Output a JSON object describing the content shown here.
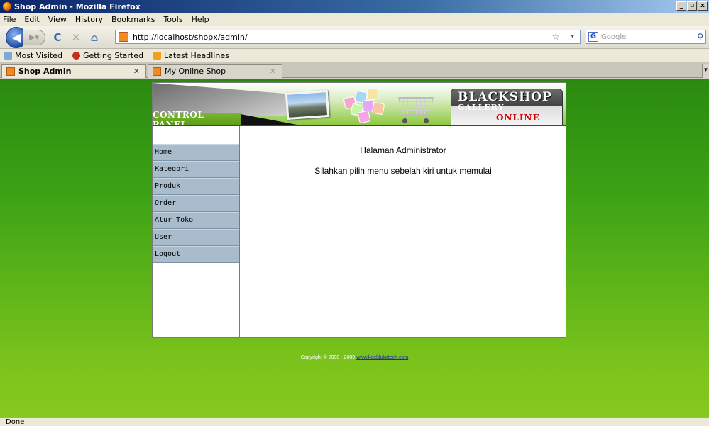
{
  "window": {
    "title": "Shop Admin - Mozilla Firefox",
    "controls": [
      "_",
      "▫",
      "x"
    ]
  },
  "menubar": {
    "items": [
      "File",
      "Edit",
      "View",
      "History",
      "Bookmarks",
      "Tools",
      "Help"
    ]
  },
  "navbar": {
    "back_icon": "back-arrow-icon",
    "forward_icon": "forward-arrow-icon",
    "url": "http://localhost/shopx/admin/",
    "search_placeholder": "Google",
    "search_engine_letter": "G"
  },
  "bookmarks": {
    "items": [
      "Most Visited",
      "Getting Started",
      "Latest Headlines"
    ]
  },
  "tabs": [
    {
      "label": "Shop Admin",
      "active": true
    },
    {
      "label": "My Online Shop",
      "active": false
    }
  ],
  "site": {
    "banner": {
      "control_panel": "CONTROL PANEL",
      "logo_main": "BLACKSHOP",
      "logo_sub": "GALLERY",
      "logo_online": "ONLINE"
    },
    "menu": [
      "Home",
      "Kategori",
      "Produk",
      "Order",
      "Atur Toko",
      "User",
      "Logout"
    ],
    "content": {
      "heading": "Halaman Administrator",
      "message": "Silahkan pilih menu sebelah kiri untuk memulai"
    },
    "footer": {
      "text": "Copyright © 2008 - 2009",
      "link": "www.koeldukatech.com"
    }
  },
  "status": {
    "text": "Done"
  },
  "colors": {
    "page_green_top": "#2a8a10",
    "page_green_bottom": "#86c81e",
    "menu_item_bg": "#a8bccb",
    "logo_online_red": "#d40000"
  }
}
